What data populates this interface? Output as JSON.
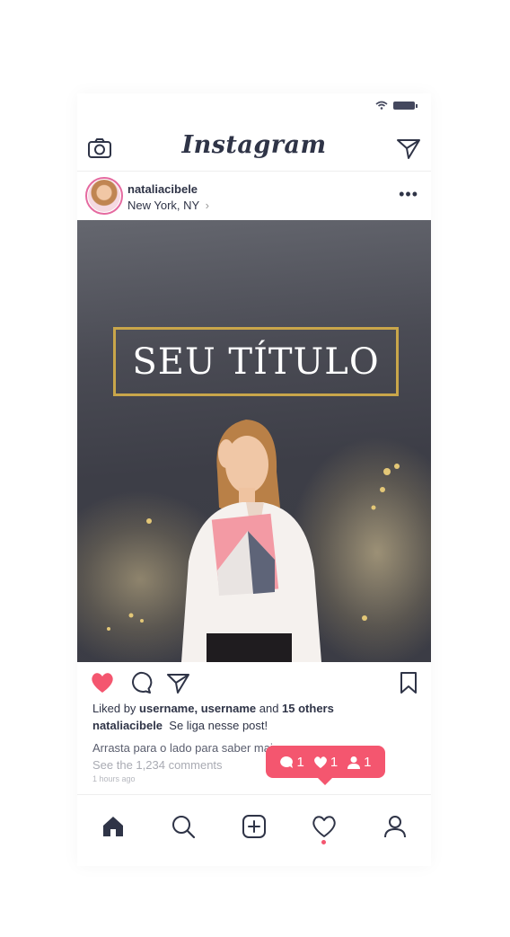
{
  "app": {
    "logo": "Instagram"
  },
  "post": {
    "username": "nataliacibele",
    "location": "New York, NY",
    "location_chevron": "›",
    "more": "•••",
    "image_title": "SEU TÍTULO"
  },
  "engagement": {
    "liked_prefix": "Liked by ",
    "liked_users": "username, username",
    "liked_and": " and ",
    "liked_others": "15 others",
    "caption_user": "nataliacibele",
    "caption_text": "Se liga nesse post!",
    "swipe_text": "Arrasta para o lado para saber mais",
    "comments_link": "See the 1,234 comments",
    "timestamp": "1 hours ago"
  },
  "notification": {
    "comments": "1",
    "likes": "1",
    "follows": "1"
  },
  "colors": {
    "accent": "#f4566f",
    "ink": "#2f3447",
    "gold": "#c9a64a"
  },
  "icons": {
    "header": [
      "camera-icon",
      "paper-plane-icon"
    ],
    "actions": [
      "heart-filled-icon",
      "comment-icon",
      "share-icon",
      "bookmark-icon"
    ],
    "tabs": [
      "home-icon",
      "search-icon",
      "add-icon",
      "heart-icon",
      "profile-icon"
    ]
  }
}
